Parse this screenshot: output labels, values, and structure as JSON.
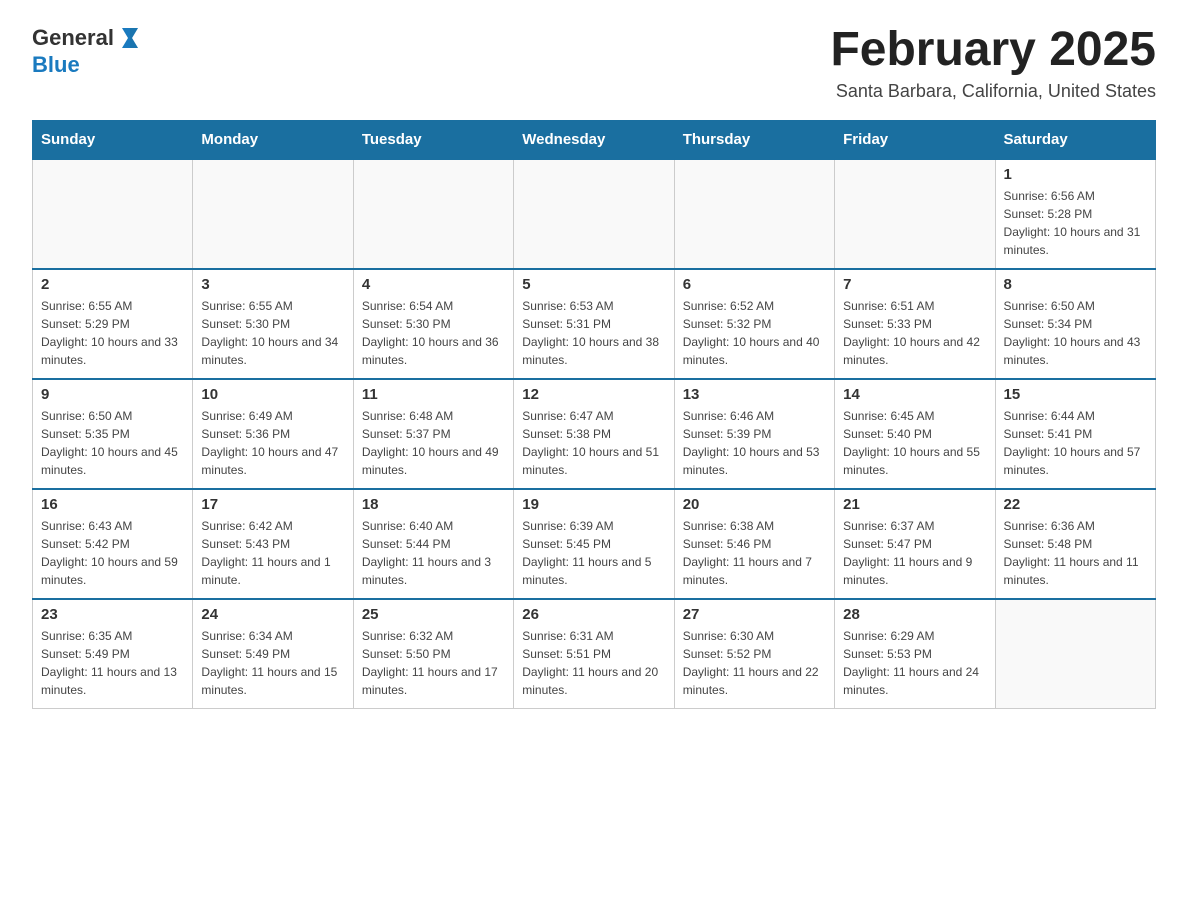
{
  "header": {
    "logo_general": "General",
    "logo_blue": "Blue",
    "title": "February 2025",
    "subtitle": "Santa Barbara, California, United States"
  },
  "days_of_week": [
    "Sunday",
    "Monday",
    "Tuesday",
    "Wednesday",
    "Thursday",
    "Friday",
    "Saturday"
  ],
  "weeks": [
    [
      {
        "day": "",
        "info": ""
      },
      {
        "day": "",
        "info": ""
      },
      {
        "day": "",
        "info": ""
      },
      {
        "day": "",
        "info": ""
      },
      {
        "day": "",
        "info": ""
      },
      {
        "day": "",
        "info": ""
      },
      {
        "day": "1",
        "info": "Sunrise: 6:56 AM\nSunset: 5:28 PM\nDaylight: 10 hours and 31 minutes."
      }
    ],
    [
      {
        "day": "2",
        "info": "Sunrise: 6:55 AM\nSunset: 5:29 PM\nDaylight: 10 hours and 33 minutes."
      },
      {
        "day": "3",
        "info": "Sunrise: 6:55 AM\nSunset: 5:30 PM\nDaylight: 10 hours and 34 minutes."
      },
      {
        "day": "4",
        "info": "Sunrise: 6:54 AM\nSunset: 5:30 PM\nDaylight: 10 hours and 36 minutes."
      },
      {
        "day": "5",
        "info": "Sunrise: 6:53 AM\nSunset: 5:31 PM\nDaylight: 10 hours and 38 minutes."
      },
      {
        "day": "6",
        "info": "Sunrise: 6:52 AM\nSunset: 5:32 PM\nDaylight: 10 hours and 40 minutes."
      },
      {
        "day": "7",
        "info": "Sunrise: 6:51 AM\nSunset: 5:33 PM\nDaylight: 10 hours and 42 minutes."
      },
      {
        "day": "8",
        "info": "Sunrise: 6:50 AM\nSunset: 5:34 PM\nDaylight: 10 hours and 43 minutes."
      }
    ],
    [
      {
        "day": "9",
        "info": "Sunrise: 6:50 AM\nSunset: 5:35 PM\nDaylight: 10 hours and 45 minutes."
      },
      {
        "day": "10",
        "info": "Sunrise: 6:49 AM\nSunset: 5:36 PM\nDaylight: 10 hours and 47 minutes."
      },
      {
        "day": "11",
        "info": "Sunrise: 6:48 AM\nSunset: 5:37 PM\nDaylight: 10 hours and 49 minutes."
      },
      {
        "day": "12",
        "info": "Sunrise: 6:47 AM\nSunset: 5:38 PM\nDaylight: 10 hours and 51 minutes."
      },
      {
        "day": "13",
        "info": "Sunrise: 6:46 AM\nSunset: 5:39 PM\nDaylight: 10 hours and 53 minutes."
      },
      {
        "day": "14",
        "info": "Sunrise: 6:45 AM\nSunset: 5:40 PM\nDaylight: 10 hours and 55 minutes."
      },
      {
        "day": "15",
        "info": "Sunrise: 6:44 AM\nSunset: 5:41 PM\nDaylight: 10 hours and 57 minutes."
      }
    ],
    [
      {
        "day": "16",
        "info": "Sunrise: 6:43 AM\nSunset: 5:42 PM\nDaylight: 10 hours and 59 minutes."
      },
      {
        "day": "17",
        "info": "Sunrise: 6:42 AM\nSunset: 5:43 PM\nDaylight: 11 hours and 1 minute."
      },
      {
        "day": "18",
        "info": "Sunrise: 6:40 AM\nSunset: 5:44 PM\nDaylight: 11 hours and 3 minutes."
      },
      {
        "day": "19",
        "info": "Sunrise: 6:39 AM\nSunset: 5:45 PM\nDaylight: 11 hours and 5 minutes."
      },
      {
        "day": "20",
        "info": "Sunrise: 6:38 AM\nSunset: 5:46 PM\nDaylight: 11 hours and 7 minutes."
      },
      {
        "day": "21",
        "info": "Sunrise: 6:37 AM\nSunset: 5:47 PM\nDaylight: 11 hours and 9 minutes."
      },
      {
        "day": "22",
        "info": "Sunrise: 6:36 AM\nSunset: 5:48 PM\nDaylight: 11 hours and 11 minutes."
      }
    ],
    [
      {
        "day": "23",
        "info": "Sunrise: 6:35 AM\nSunset: 5:49 PM\nDaylight: 11 hours and 13 minutes."
      },
      {
        "day": "24",
        "info": "Sunrise: 6:34 AM\nSunset: 5:49 PM\nDaylight: 11 hours and 15 minutes."
      },
      {
        "day": "25",
        "info": "Sunrise: 6:32 AM\nSunset: 5:50 PM\nDaylight: 11 hours and 17 minutes."
      },
      {
        "day": "26",
        "info": "Sunrise: 6:31 AM\nSunset: 5:51 PM\nDaylight: 11 hours and 20 minutes."
      },
      {
        "day": "27",
        "info": "Sunrise: 6:30 AM\nSunset: 5:52 PM\nDaylight: 11 hours and 22 minutes."
      },
      {
        "day": "28",
        "info": "Sunrise: 6:29 AM\nSunset: 5:53 PM\nDaylight: 11 hours and 24 minutes."
      },
      {
        "day": "",
        "info": ""
      }
    ]
  ]
}
